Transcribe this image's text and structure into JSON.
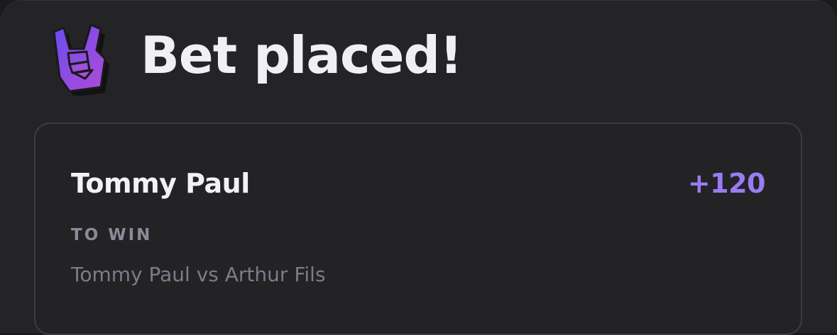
{
  "header": {
    "title": "Bet placed!",
    "logo_icon": "rock-hand-icon"
  },
  "bet": {
    "selection": "Tommy Paul",
    "odds": "+120",
    "market": "TO WIN",
    "matchup": "Tommy Paul vs Arthur Fils"
  },
  "colors": {
    "background": "#242427",
    "accent": "#9a7cf2",
    "card_border": "#3c3a45"
  }
}
